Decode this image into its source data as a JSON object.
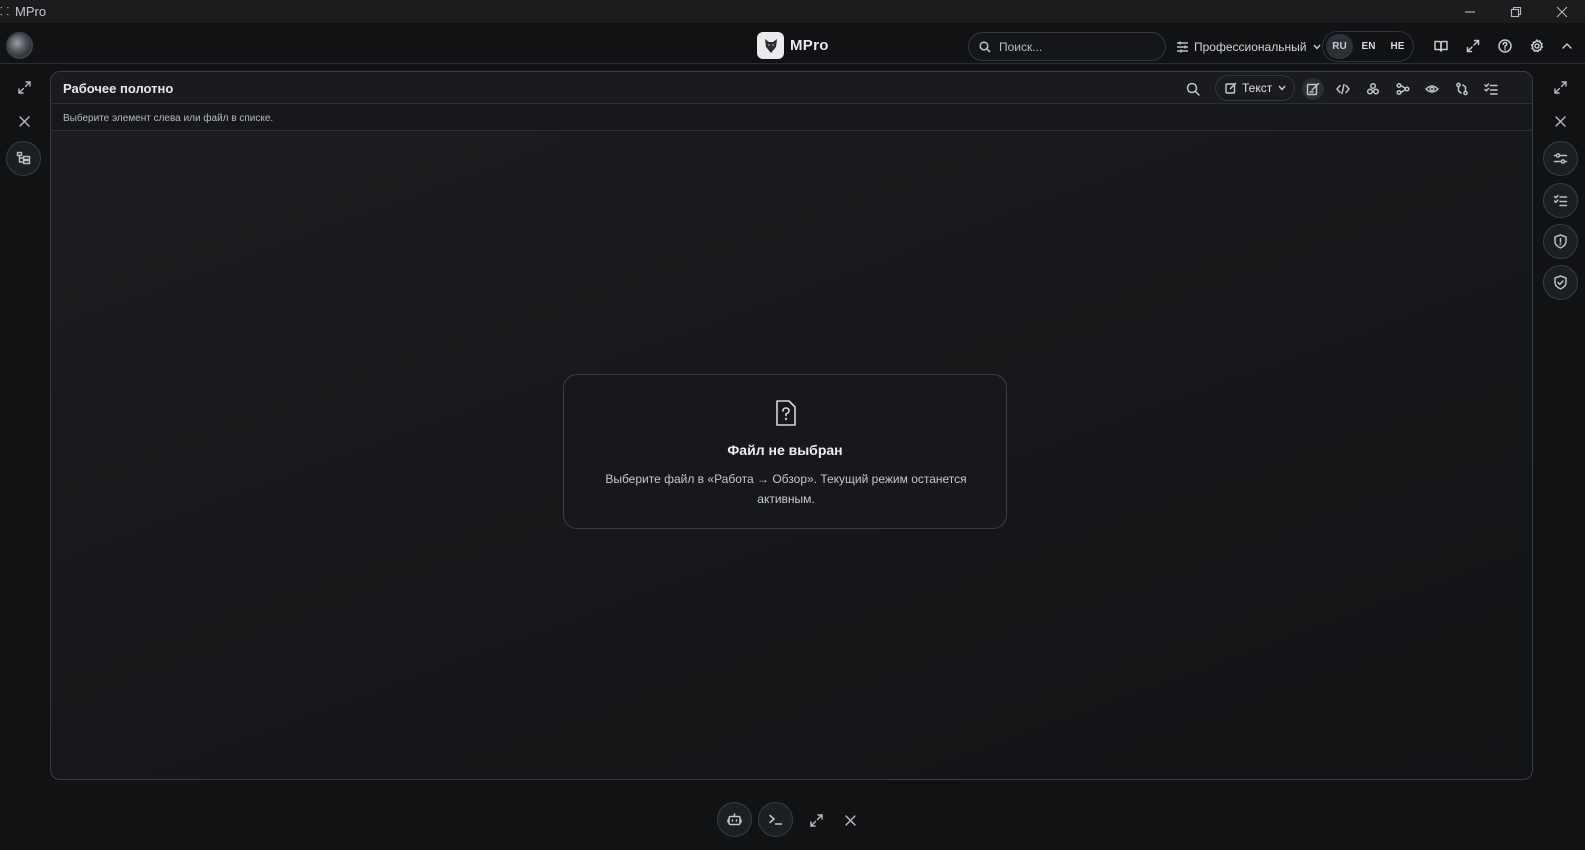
{
  "window": {
    "title": "MPro"
  },
  "topbar": {
    "brand_name": "MPro",
    "search_placeholder": "Поиск...",
    "mode_label": "Профессиональный",
    "languages": [
      "RU",
      "EN",
      "HE"
    ],
    "active_language": "RU",
    "icons": [
      "book-icon",
      "expand-icon",
      "help-icon",
      "settings-icon",
      "chevron-up-icon"
    ]
  },
  "canvas": {
    "title": "Рабочее полотно",
    "hint": "Выберите элемент слева или файл в списке.",
    "view_select_label": "Текст",
    "toolbar_icons": [
      "search-icon",
      "edit-icon",
      "code-icon",
      "graph-icon",
      "flow-icon",
      "preview-icon",
      "compare-icon",
      "checklist-icon"
    ],
    "active_tool": "edit-icon"
  },
  "empty_state": {
    "title": "Файл не выбран",
    "description": "Выберите файл в «Работа → Обзор». Текущий режим останется активным."
  },
  "left_rail": {
    "icons": [
      "expand-icon",
      "close-icon",
      "tree-icon"
    ]
  },
  "right_rail": {
    "icons": [
      "expand-icon",
      "close-icon",
      "sliders-icon",
      "checklist-icon",
      "shield-alert-icon",
      "shield-check-icon"
    ]
  },
  "bottom_toolbar": {
    "icons": [
      "bot-icon",
      "terminal-icon",
      "expand-icon",
      "close-icon"
    ]
  },
  "colors": {
    "background": "#101214",
    "panel_border": "#3a3e43",
    "text_primary": "#e6e8eb"
  }
}
